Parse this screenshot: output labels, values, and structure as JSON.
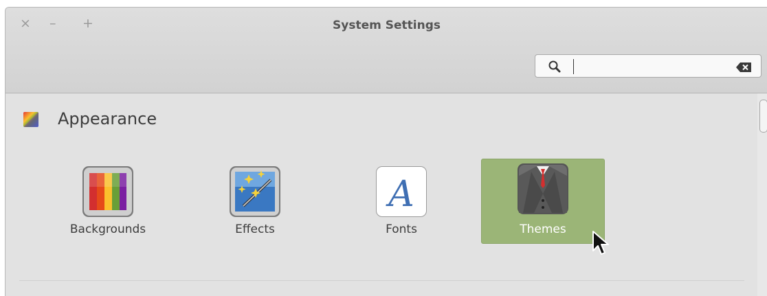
{
  "window": {
    "title": "System Settings",
    "controls": {
      "close": "×",
      "minimize": "–",
      "maximize": "+"
    }
  },
  "search": {
    "value": "",
    "placeholder": "",
    "icon": "search-icon",
    "clear_icon": "clear-text-icon"
  },
  "section": {
    "title": "Appearance",
    "icon": "appearance-icon",
    "items": [
      {
        "label": "Backgrounds",
        "icon": "backgrounds-icon",
        "selected": false
      },
      {
        "label": "Effects",
        "icon": "effects-icon",
        "selected": false
      },
      {
        "label": "Fonts",
        "icon": "fonts-icon",
        "selected": false
      },
      {
        "label": "Themes",
        "icon": "themes-icon",
        "selected": true
      }
    ],
    "fonts_glyph": "A"
  },
  "colors": {
    "selection": "#9bb577",
    "window_bg": "#e2e2e2",
    "titlebar_bg": "#d6d6d6"
  }
}
